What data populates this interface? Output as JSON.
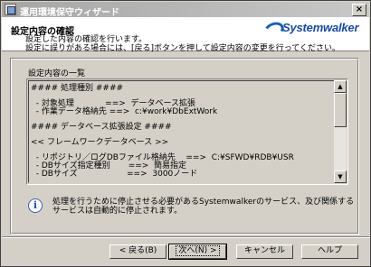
{
  "window": {
    "title": "運用環境保守ウィザード",
    "close_glyph": "×"
  },
  "header": {
    "title": "設定内容の確認",
    "logo_text": "Systemwalker",
    "desc_line1": "設定した内容の確認を行います。",
    "desc_line2": "設定に誤りがある場合には、[戻る]ボタンを押して設定内容の変更を行ってください。"
  },
  "summary": {
    "label": "設定内容の一覧",
    "lines": [
      "#### 処理種別 ####",
      "",
      "  - 対象処理            ==>  データベース拡張",
      "  - 作業データ格納先 ==>  c:¥work¥DbExtWork",
      "",
      "#### データベース拡張設定 ####",
      "",
      "<< フレームワークデータベース >>",
      "",
      "  - リポジトリ／ログDBファイル格納先    ==>  C:¥SFWD¥RDB¥USR",
      "  - DBサイズ指定種別       ==>  簡易指定",
      "  - DBサイズ                   ==>  3000ノード"
    ],
    "scroll_up": "▲",
    "scroll_down": "▼"
  },
  "info": {
    "icon": "i",
    "line1": "処理を行うために停止させる必要があるSystemwalkerのサービス、及び関係する",
    "line2": "サービスは自動的に停止されます。"
  },
  "buttons": {
    "back": "< 戻る(B)",
    "next": "次へ(N) >",
    "cancel": "キャンセル",
    "help": "ヘルプ"
  }
}
